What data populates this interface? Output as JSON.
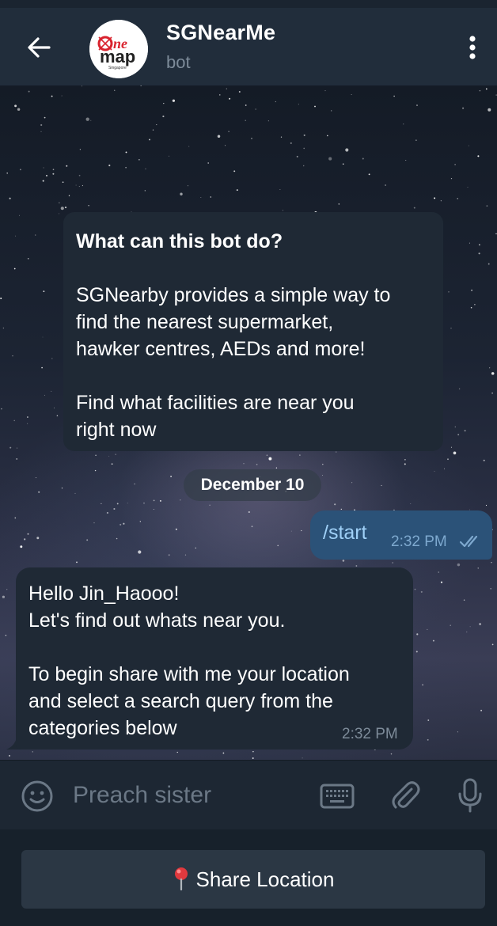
{
  "header": {
    "title": "SGNearMe",
    "subtitle": "bot",
    "avatar_logo_text": "One map Singapore",
    "icons": [
      "back-arrow-icon",
      "more-vertical-icon"
    ]
  },
  "intro_card": {
    "heading": "What can this bot do?",
    "paragraph1_lines": [
      "SGNearby provides a simple way to",
      "find the nearest supermarket,",
      "hawker centres, AEDs and more!"
    ],
    "paragraph2_lines": [
      "Find what facilities are near you",
      "right now"
    ]
  },
  "date_separator": "December 10",
  "outgoing_message": {
    "text": "/start",
    "time": "2:32 PM",
    "status": "read"
  },
  "incoming_message": {
    "lines1": [
      "Hello Jin_Haooo!",
      "Let's find out whats near you."
    ],
    "lines2": [
      "To begin share with me your location",
      "and select a search query from the",
      "categories below"
    ],
    "time": "2:32 PM"
  },
  "composer": {
    "placeholder": "Preach sister",
    "icons": [
      "emoji-icon",
      "keyboard-icon",
      "attach-icon",
      "mic-icon"
    ]
  },
  "bot_keyboard": {
    "button_label": "Share Location",
    "button_icon": "pin-icon"
  },
  "colors": {
    "header_bg": "#212d3b",
    "bubble_in": "#1f2935",
    "bubble_out": "#2b5278",
    "out_text": "#9fd0f7",
    "keyboard_bg": "#17212b",
    "button_bg": "#2b3744",
    "pin_red": "#e0393e"
  }
}
